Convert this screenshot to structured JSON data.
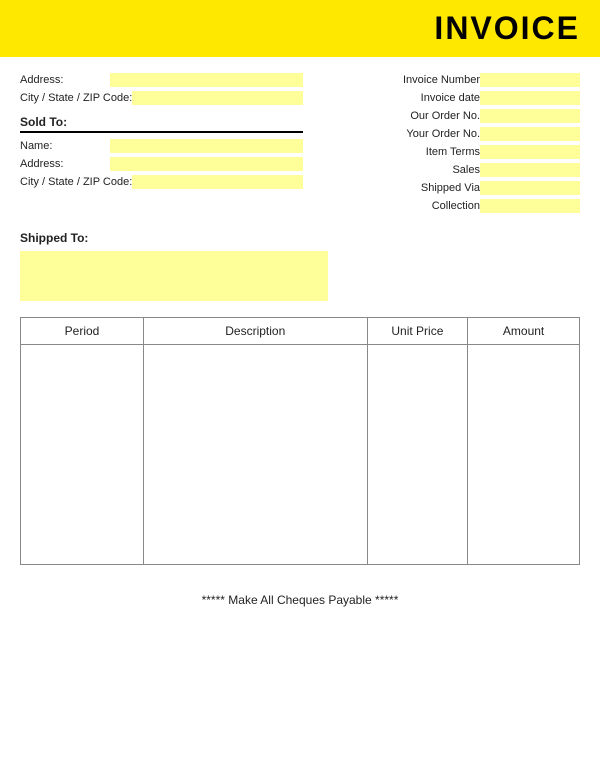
{
  "header": {
    "title": "INVOICE"
  },
  "left": {
    "address_label": "Address:",
    "city_label": "City / State / ZIP Code:",
    "sold_to_label": "Sold To:",
    "name_label": "Name:",
    "address2_label": "Address:",
    "city2_label": "City / State / ZIP Code:",
    "shipped_to_label": "Shipped To:"
  },
  "right": {
    "invoice_number_label": "Invoice Number",
    "invoice_date_label": "Invoice date",
    "our_order_label": "Our Order No.",
    "your_order_label": "Your Order No.",
    "item_terms_label": "Item Terms",
    "sales_label": "Sales",
    "shipped_via_label": "Shipped Via",
    "collection_label": "Collection"
  },
  "table": {
    "col_period": "Period",
    "col_description": "Description",
    "col_unit_price": "Unit Price",
    "col_amount": "Amount"
  },
  "footer": {
    "text": "***** Make All Cheques Payable *****"
  }
}
